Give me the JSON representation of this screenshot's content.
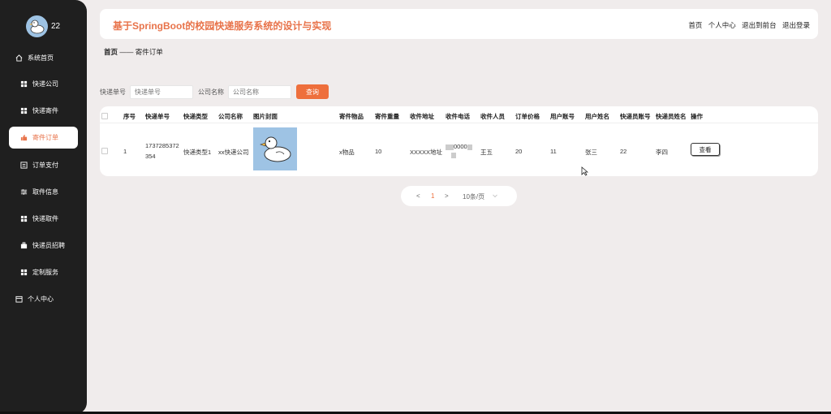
{
  "sidebar": {
    "user_name": "22",
    "items": [
      {
        "label": "系统首页",
        "icon": "home-icon"
      },
      {
        "label": "快递公司",
        "icon": "grid-icon"
      },
      {
        "label": "快递寄件",
        "icon": "grid-icon"
      },
      {
        "label": "寄件订单",
        "icon": "thumb-icon"
      },
      {
        "label": "订单支付",
        "icon": "list-icon"
      },
      {
        "label": "取件信息",
        "icon": "sliders-icon"
      },
      {
        "label": "快递取件",
        "icon": "grid-icon"
      },
      {
        "label": "快递员招聘",
        "icon": "briefcase-icon"
      },
      {
        "label": "定制服务",
        "icon": "grid-icon"
      },
      {
        "label": "个人中心",
        "icon": "calendar-icon"
      }
    ],
    "active_index": 3
  },
  "header": {
    "title": "基于SpringBoot的校园快递服务系统的设计与实现",
    "links": [
      "首页",
      "个人中心",
      "退出到前台",
      "退出登录"
    ]
  },
  "breadcrumb": {
    "home": "首页",
    "separator": "——",
    "current": "寄件订单"
  },
  "search": {
    "tracking_label": "快递单号",
    "tracking_placeholder": "快递单号",
    "company_label": "公司名称",
    "company_placeholder": "公司名称",
    "button_label": "查询"
  },
  "table": {
    "headers": [
      "序号",
      "快递单号",
      "快递类型",
      "公司名称",
      "图片封面",
      "寄件物品",
      "寄件重量",
      "收件地址",
      "收件电话",
      "收件人员",
      "订单价格",
      "用户账号",
      "用户姓名",
      "快递员账号",
      "快递员姓名",
      "操作"
    ],
    "rows": [
      {
        "index": "1",
        "tracking_line1": "1737285372",
        "tracking_line2": "354",
        "type": "快递类型1",
        "company": "xx快递公司",
        "item": "x物品",
        "weight": "10",
        "address": "XXXXX地址",
        "phone": "0000",
        "receiver": "王五",
        "price": "20",
        "user_account": "11",
        "user_name": "张三",
        "courier_account": "22",
        "courier_name": "李四",
        "action": "查看"
      }
    ]
  },
  "pagination": {
    "prev": "<",
    "current_page": "1",
    "next": ">",
    "page_size": "10条/页"
  },
  "colors": {
    "accent": "#ee6f3c",
    "title": "#e8734a",
    "sidebar_bg": "#1f1f1f",
    "page_bg": "#f0ecec"
  }
}
